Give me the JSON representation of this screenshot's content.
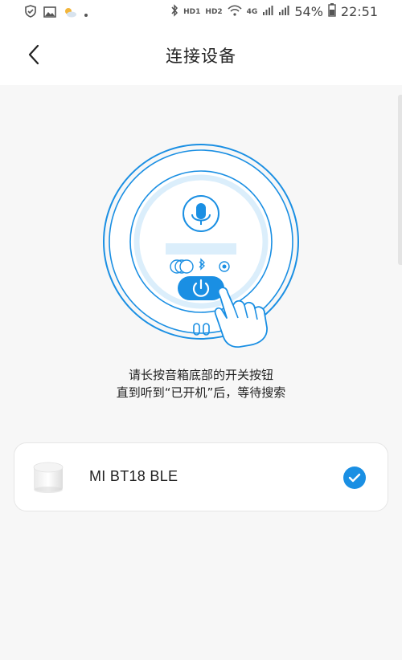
{
  "status_bar": {
    "hd1": "HD1",
    "hd2": "HD2",
    "net": "4G",
    "battery": "54%",
    "time": "22:51"
  },
  "header": {
    "title": "连接设备"
  },
  "instructions": {
    "line1": "请长按音箱底部的开关按钮",
    "line2": "直到听到“已开机”后，等待搜索"
  },
  "devices": [
    {
      "name": "MI BT18 BLE",
      "selected": true
    }
  ],
  "colors": {
    "accent": "#1a8fe3",
    "ring_light": "#dbeefb",
    "background": "#f7f7f7"
  },
  "icons": {
    "back": "chevron-left-icon",
    "mic": "microphone-icon",
    "power": "power-icon",
    "check": "checkmark-icon"
  }
}
